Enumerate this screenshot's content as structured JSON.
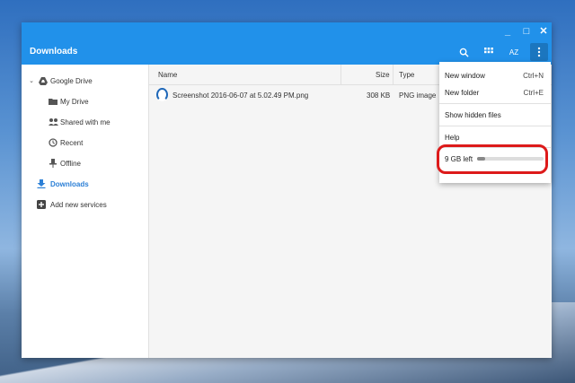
{
  "window": {
    "controls": {
      "minimize": "_",
      "maximize": "□",
      "close": "✕"
    }
  },
  "appbar": {
    "title": "Downloads",
    "tools": [
      "search-icon",
      "grid-view-icon",
      "sort-icon",
      "more-vert-icon"
    ],
    "sort_label": "AZ"
  },
  "sidebar": {
    "items": [
      {
        "label": "Google Drive",
        "icon": "drive-icon"
      },
      {
        "label": "My Drive",
        "icon": "folder-icon"
      },
      {
        "label": "Shared with me",
        "icon": "people-icon"
      },
      {
        "label": "Recent",
        "icon": "clock-icon"
      },
      {
        "label": "Offline",
        "icon": "pin-icon"
      },
      {
        "label": "Downloads",
        "icon": "download-icon",
        "selected": true
      },
      {
        "label": "Add new services",
        "icon": "add-icon"
      }
    ]
  },
  "table": {
    "columns": [
      "Name",
      "Size",
      "Type"
    ],
    "rows": [
      {
        "name": "Screenshot 2016-06-07 at 5.02.49 PM.png",
        "size": "308 KB",
        "type": "PNG image"
      }
    ]
  },
  "menu": {
    "new_window": {
      "label": "New window",
      "shortcut": "Ctrl+N"
    },
    "new_folder": {
      "label": "New folder",
      "shortcut": "Ctrl+E"
    },
    "show_hidden": {
      "label": "Show hidden files"
    },
    "help": {
      "label": "Help"
    },
    "storage": {
      "label": "9 GB left",
      "used_fraction": 0.12
    }
  },
  "colors": {
    "accent": "#2191ea",
    "highlight": "#dd1a1a",
    "selected": "#2b7fd6"
  }
}
